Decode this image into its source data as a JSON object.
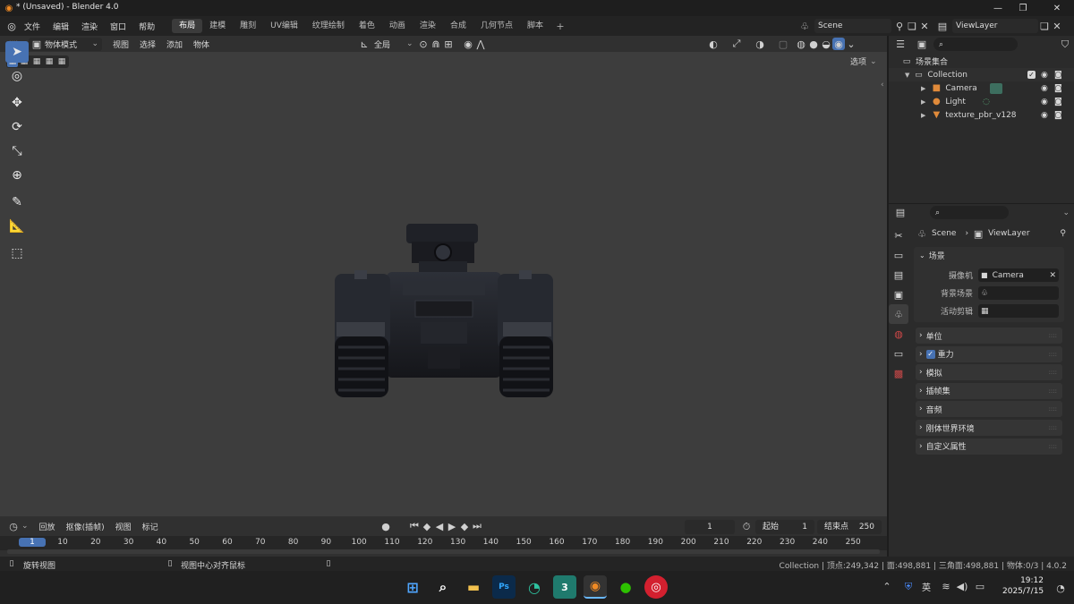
{
  "window": {
    "title": "* (Unsaved) - Blender 4.0"
  },
  "menu": [
    "文件",
    "编辑",
    "渲染",
    "窗口",
    "帮助"
  ],
  "workspaces": [
    "布局",
    "建模",
    "雕刻",
    "UV编辑",
    "纹理绘制",
    "着色",
    "动画",
    "渲染",
    "合成",
    "几何节点",
    "脚本"
  ],
  "active_workspace": "布局",
  "scene": {
    "label": "Scene",
    "view_layer": "ViewLayer"
  },
  "viewport": {
    "mode": "物体模式",
    "menus": [
      "视图",
      "选择",
      "添加",
      "物体"
    ],
    "transform_orientation": "全局",
    "options_label": "选项"
  },
  "timeline": {
    "menus": [
      "回放",
      "抠像(插帧)",
      "视图",
      "标记"
    ],
    "current_frame": "1",
    "start_label": "起始",
    "start_value": "1",
    "end_label": "结束点",
    "end_value": "250",
    "ticks": [
      "1",
      "10",
      "20",
      "30",
      "40",
      "50",
      "60",
      "70",
      "80",
      "90",
      "100",
      "110",
      "120",
      "130",
      "140",
      "150",
      "160",
      "170",
      "180",
      "190",
      "200",
      "210",
      "220",
      "230",
      "240",
      "250"
    ]
  },
  "outliner": {
    "root": "场景集合",
    "collection": "Collection",
    "items": [
      "Camera",
      "Light",
      "texture_pbr_v128"
    ]
  },
  "properties": {
    "breadcrumb_scene": "Scene",
    "breadcrumb_layer": "ViewLayer",
    "section": "场景",
    "camera_label": "摄像机",
    "camera_value": "Camera",
    "background_label": "背景场景",
    "clip_label": "活动剪辑",
    "panels": [
      "单位",
      "重力",
      "模拟",
      "插帧集",
      "音频",
      "刚体世界环境",
      "自定义属性"
    ]
  },
  "status": {
    "left1": "旋转视图",
    "left2": "视图中心对齐鼠标",
    "stats": "Collection | 顶点:249,342 | 面:498,881 | 三角面:498,881 | 物体:0/3 | 4.0.2"
  },
  "taskbar": {
    "lang": "英",
    "time": "19:12",
    "date": "2025/7/15"
  },
  "colors": {
    "accent": "#4772b3",
    "viewport_bg": "#3d3d3d",
    "panel_bg": "#2b2b2b"
  }
}
